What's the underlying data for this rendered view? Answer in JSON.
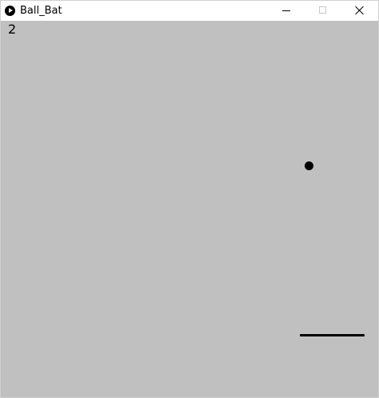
{
  "window": {
    "title": "Ball_Bat",
    "app_icon": "processing-play-icon",
    "controls": {
      "minimize": "minimize-icon",
      "maximize": "maximize-icon",
      "close": "close-icon"
    }
  },
  "game": {
    "score": "2",
    "background_color": "#c0c0c0",
    "ball_color": "#000000",
    "bat_color": "#000000"
  }
}
